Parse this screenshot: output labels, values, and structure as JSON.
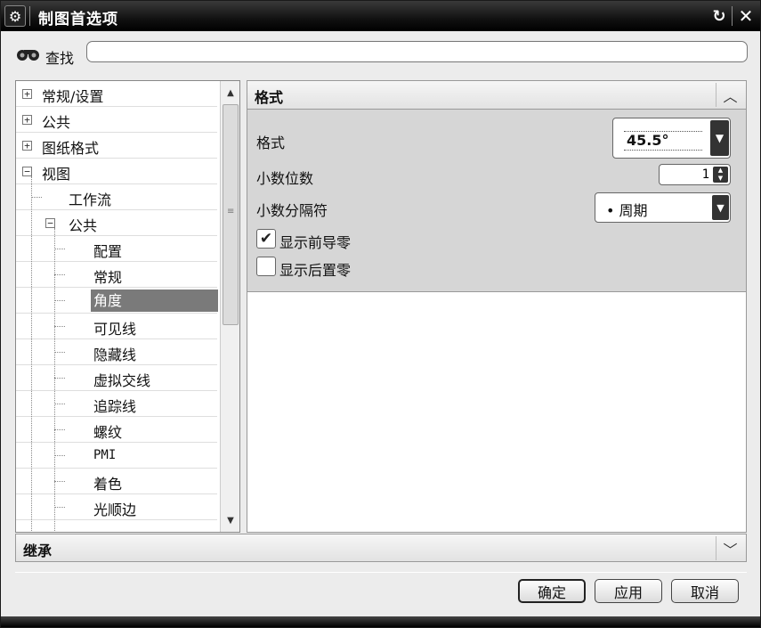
{
  "window": {
    "title": "制图首选项"
  },
  "search": {
    "label": "查找",
    "value": "",
    "placeholder": ""
  },
  "tree": {
    "items": [
      {
        "label": "常规/设置",
        "expander": "+"
      },
      {
        "label": "公共",
        "expander": "+"
      },
      {
        "label": "图纸格式",
        "expander": "+"
      },
      {
        "label": "视图",
        "expander": "−"
      },
      {
        "label": "工作流"
      },
      {
        "label": "公共",
        "expander": "−"
      },
      {
        "label": "配置"
      },
      {
        "label": "常规"
      },
      {
        "label": "角度",
        "selected": true
      },
      {
        "label": "可见线"
      },
      {
        "label": "隐藏线"
      },
      {
        "label": "虚拟交线"
      },
      {
        "label": "追踪线"
      },
      {
        "label": "螺纹"
      },
      {
        "label": "PMI"
      },
      {
        "label": "着色"
      },
      {
        "label": "光顺边"
      }
    ]
  },
  "format_panel": {
    "title": "格式",
    "format_label": "格式",
    "format_value": "45.5°",
    "decimals_label": "小数位数",
    "decimals_value": "1",
    "separator_label": "小数分隔符",
    "separator_value": "• 周期",
    "leading_zero_label": "显示前导零",
    "leading_zero_checked": true,
    "trailing_zero_label": "显示后置零",
    "trailing_zero_checked": false
  },
  "inherit_panel": {
    "title": "继承"
  },
  "buttons": {
    "ok": "确定",
    "apply": "应用",
    "cancel": "取消"
  }
}
